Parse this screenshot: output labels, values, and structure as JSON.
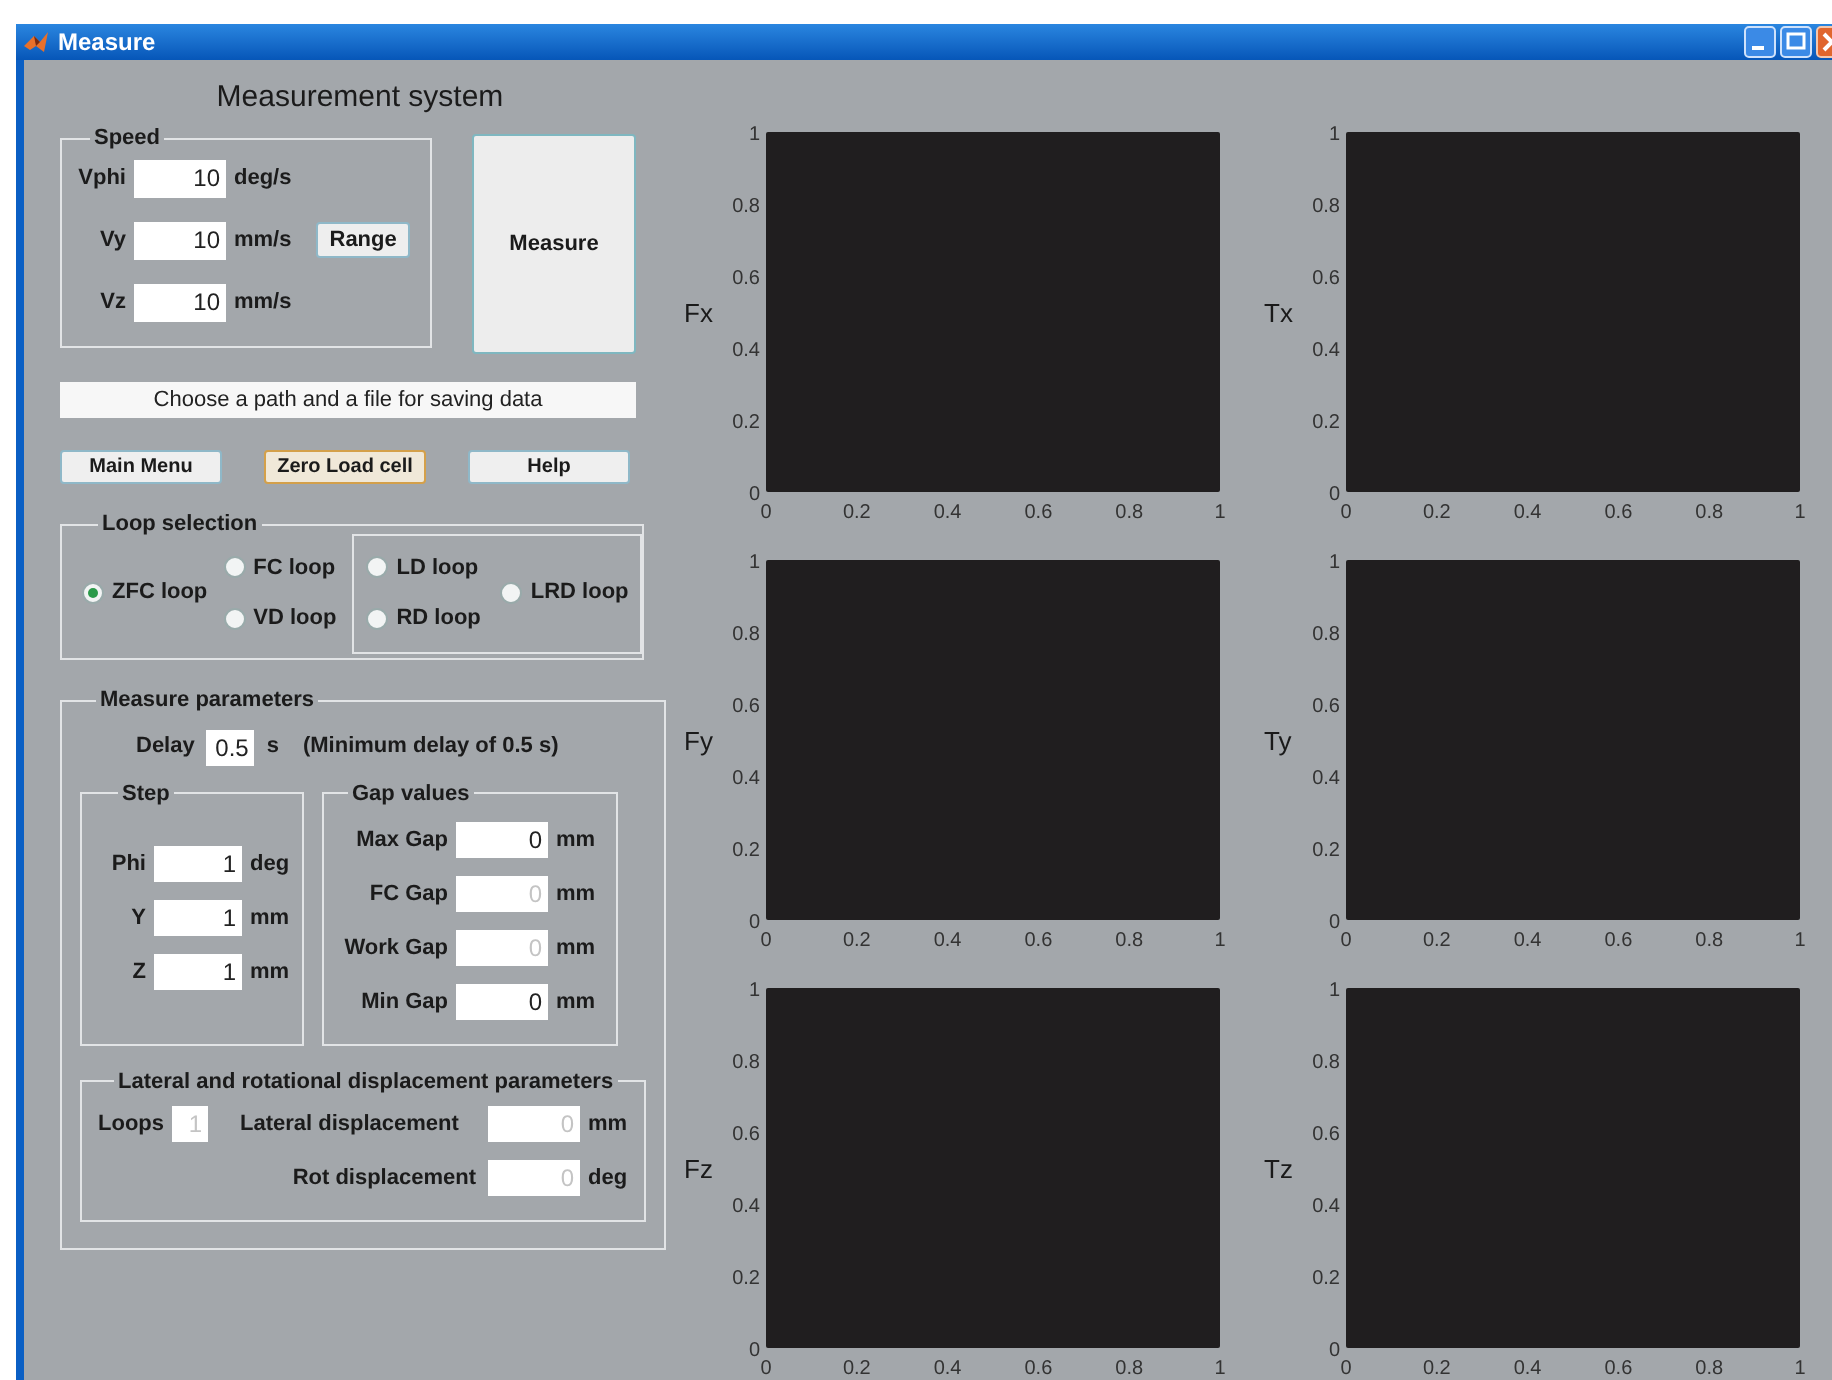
{
  "window": {
    "title": "Measure"
  },
  "heading": "Measurement system",
  "speed": {
    "title": "Speed",
    "range_button": "Range",
    "fields": [
      {
        "label": "Vphi",
        "value": "10",
        "unit": "deg/s"
      },
      {
        "label": "Vy",
        "value": "10",
        "unit": "mm/s"
      },
      {
        "label": "Vz",
        "value": "10",
        "unit": "mm/s"
      }
    ]
  },
  "measure_button": "Measure",
  "path_field": {
    "value": "Choose a path and a file for saving data"
  },
  "buttons": [
    {
      "label": "Main Menu",
      "focused": false
    },
    {
      "label": "Zero Load cell",
      "focused": true
    },
    {
      "label": "Help",
      "focused": false
    }
  ],
  "loop_selection": {
    "title": "Loop selection",
    "columns": [
      [
        {
          "label": "ZFC loop",
          "selected": true
        }
      ],
      [
        {
          "label": "FC loop",
          "selected": false
        },
        {
          "label": "VD loop",
          "selected": false
        }
      ]
    ],
    "framed_group": {
      "columns": [
        [
          {
            "label": "LD loop",
            "selected": false
          },
          {
            "label": "RD loop",
            "selected": false
          }
        ],
        [
          {
            "label": "LRD loop",
            "selected": false
          }
        ]
      ]
    }
  },
  "measure_parameters": {
    "title": "Measure parameters",
    "delay": {
      "label": "Delay",
      "value": "0.5",
      "unit": "s",
      "note": "(Minimum delay of 0.5 s)"
    },
    "step": {
      "title": "Step",
      "fields": [
        {
          "label": "Phi",
          "value": "1",
          "unit": "deg",
          "disabled": false
        },
        {
          "label": "Y",
          "value": "1",
          "unit": "mm",
          "disabled": false
        },
        {
          "label": "Z",
          "value": "1",
          "unit": "mm",
          "disabled": false
        }
      ]
    },
    "gap_values": {
      "title": "Gap values",
      "fields": [
        {
          "label": "Max Gap",
          "value": "0",
          "unit": "mm",
          "disabled": false
        },
        {
          "label": "FC Gap",
          "value": "0",
          "unit": "mm",
          "disabled": true
        },
        {
          "label": "Work Gap",
          "value": "0",
          "unit": "mm",
          "disabled": true
        },
        {
          "label": "Min Gap",
          "value": "0",
          "unit": "mm",
          "disabled": false
        }
      ]
    },
    "displacement": {
      "title": "Lateral and rotational displacement parameters",
      "loops": {
        "label": "Loops",
        "value": "1",
        "disabled": true
      },
      "fields": [
        {
          "label": "Lateral displacement",
          "value": "0",
          "unit": "mm",
          "disabled": true
        },
        {
          "label": "Rot displacement",
          "value": "0",
          "unit": "deg",
          "disabled": true
        }
      ]
    }
  },
  "plots": [
    {
      "chart_data": {
        "type": "line",
        "ylabel": "Fx",
        "xlim": [
          0,
          1
        ],
        "ylim": [
          0,
          1
        ],
        "xticks": [
          0,
          0.2,
          0.4,
          0.6,
          0.8,
          1
        ],
        "yticks": [
          0,
          0.2,
          0.4,
          0.6,
          0.8,
          1
        ]
      }
    },
    {
      "chart_data": {
        "type": "line",
        "ylabel": "Tx",
        "xlim": [
          0,
          1
        ],
        "ylim": [
          0,
          1
        ],
        "xticks": [
          0,
          0.2,
          0.4,
          0.6,
          0.8,
          1
        ],
        "yticks": [
          0,
          0.2,
          0.4,
          0.6,
          0.8,
          1
        ]
      }
    },
    {
      "chart_data": {
        "type": "line",
        "ylabel": "Fy",
        "xlim": [
          0,
          1
        ],
        "ylim": [
          0,
          1
        ],
        "xticks": [
          0,
          0.2,
          0.4,
          0.6,
          0.8,
          1
        ],
        "yticks": [
          0,
          0.2,
          0.4,
          0.6,
          0.8,
          1
        ]
      }
    },
    {
      "chart_data": {
        "type": "line",
        "ylabel": "Ty",
        "xlim": [
          0,
          1
        ],
        "ylim": [
          0,
          1
        ],
        "xticks": [
          0,
          0.2,
          0.4,
          0.6,
          0.8,
          1
        ],
        "yticks": [
          0,
          0.2,
          0.4,
          0.6,
          0.8,
          1
        ]
      }
    },
    {
      "chart_data": {
        "type": "line",
        "ylabel": "Fz",
        "xlim": [
          0,
          1
        ],
        "ylim": [
          0,
          1
        ],
        "xticks": [
          0,
          0.2,
          0.4,
          0.6,
          0.8,
          1
        ],
        "yticks": [
          0,
          0.2,
          0.4,
          0.6,
          0.8,
          1
        ]
      }
    },
    {
      "chart_data": {
        "type": "line",
        "ylabel": "Tz",
        "xlim": [
          0,
          1
        ],
        "ylim": [
          0,
          1
        ],
        "xticks": [
          0,
          0.2,
          0.4,
          0.6,
          0.8,
          1
        ],
        "yticks": [
          0,
          0.2,
          0.4,
          0.6,
          0.8,
          1
        ]
      }
    }
  ]
}
